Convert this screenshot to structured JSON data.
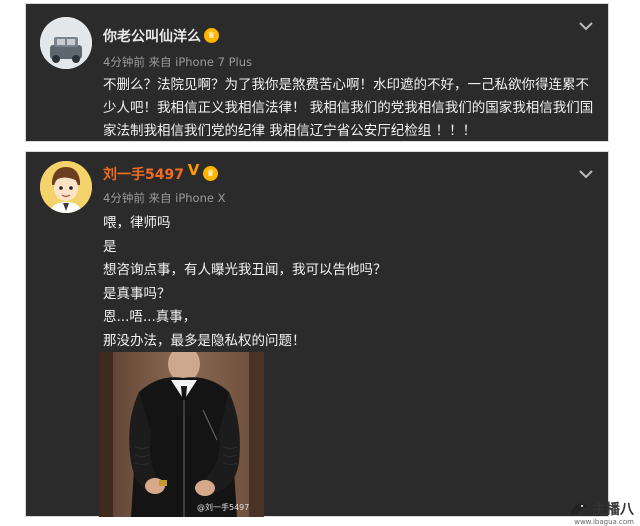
{
  "post1": {
    "username": "你老公叫仙洋么",
    "meta": "4分钟前 来自 iPhone 7 Plus",
    "text": "不删么？法院见啊？为了我你是煞费苦心啊！水印遮的不好，一己私欲你得连累不少人吧！我相信正义我相信法律！ 我相信我们的党我相信我们的国家我相信我们国家法制我相信我们党的纪律 我相信辽宁省公安厅纪检组 ！！！"
  },
  "post2": {
    "username": "刘一手5497",
    "meta": "4分钟前 来自 iPhone X",
    "lines": [
      "喂，律师吗",
      "是",
      "想咨询点事，有人曝光我丑闻，我可以告他吗？",
      "是真事吗？",
      "恩...唔...真事，",
      "那没办法，最多是隐私权的问题！"
    ],
    "photo_watermark": "@刘一手5497"
  },
  "site": {
    "logo_text": "主播八",
    "logo_url": "www.ibagua.com"
  },
  "colors": {
    "card_bg": "#2b2b2b",
    "username_highlight": "#f26d21",
    "meta_gray": "#9a9a9a"
  },
  "icons": [
    "chevron-down-icon",
    "vip-badge-icon",
    "verified-v-icon"
  ]
}
